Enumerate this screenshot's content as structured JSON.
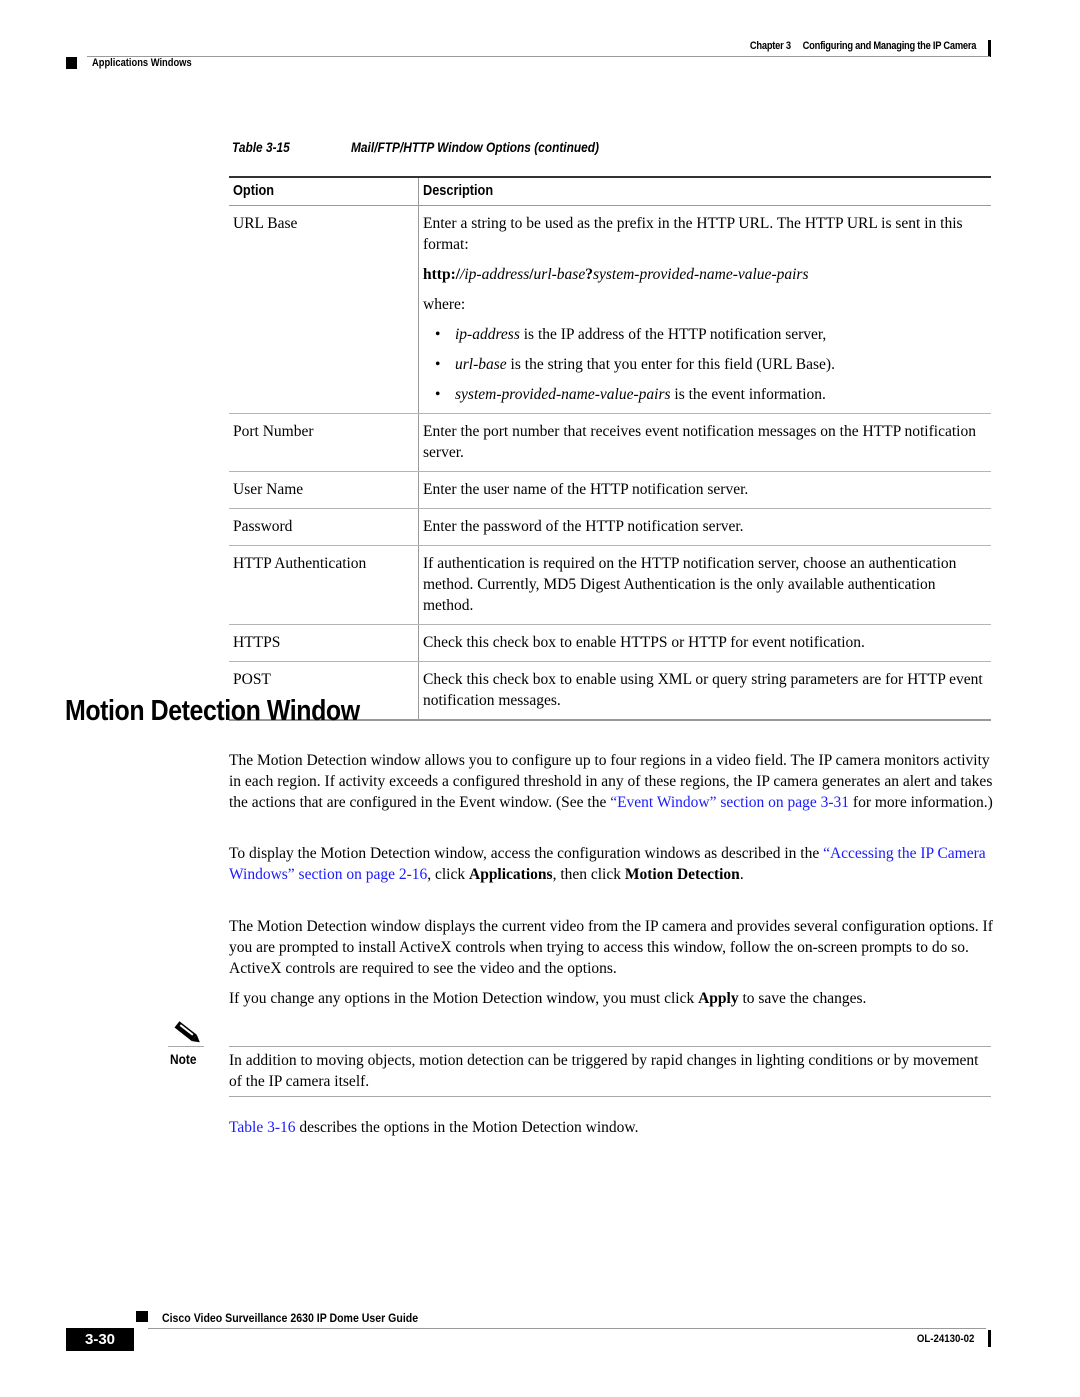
{
  "header": {
    "chapter_number": "Chapter 3",
    "chapter_title": "Configuring and Managing the IP Camera",
    "section": "Applications Windows"
  },
  "table": {
    "caption_label": "Table 3-15",
    "caption_title": "Mail/FTP/HTTP Window Options (continued)",
    "columns": [
      "Option",
      "Description"
    ],
    "rows": [
      {
        "option": "URL Base",
        "description": "Enter a string to be used as the prefix in the HTTP URL. The HTTP URL is sent in this format:",
        "format_bold_1": "http:/",
        "format_italic_1": "/ip-address",
        "format_bold_2": "/",
        "format_italic_2": "url-base",
        "format_bold_3": "?",
        "format_italic_3": "system-provided-name-value-pairs",
        "where": "where:",
        "bullets": [
          {
            "term": "ip-address",
            "text": " is the IP address of the HTTP notification server,"
          },
          {
            "term": "url-base",
            "text": " is the string that you enter for this field (URL Base)."
          },
          {
            "term": "system-provided-name-value-pairs",
            "text": " is the event information."
          }
        ]
      },
      {
        "option": "Port Number",
        "description": "Enter the port number that receives event notification messages on the HTTP notification server."
      },
      {
        "option": "User Name",
        "description": "Enter the user name of the HTTP notification server."
      },
      {
        "option": "Password",
        "description": "Enter the password of the HTTP notification server."
      },
      {
        "option": "HTTP Authentication",
        "description": "If authentication is required on the HTTP notification server, choose an authentication method. Currently, MD5 Digest Authentication is the only available authentication method."
      },
      {
        "option": "HTTPS",
        "description": "Check this check box to enable HTTPS or HTTP for event notification."
      },
      {
        "option": "POST",
        "description": "Check this check box to enable using XML or query string parameters are for HTTP event notification messages."
      }
    ]
  },
  "section": {
    "title": "Motion Detection Window",
    "p1_text": "The Motion Detection window allows you to configure up to four regions in a video field. The IP camera monitors activity in each region. If activity exceeds a configured threshold in any of these regions, the IP camera generates an alert and takes the actions that are configured in the Event window. (See the ",
    "p1_link": "“Event Window” section on page 3-31",
    "p1_tail": " for more information.)",
    "p2_text": "To display the Motion Detection window, access the configuration windows as described in the ",
    "p2_link": "“Accessing the IP Camera Windows” section on page 2-16",
    "p2_mid": ", click ",
    "p2_bold1": "Applications",
    "p2_mid2": ", then click ",
    "p2_bold2": "Motion Detection",
    "p2_tail": ".",
    "p3_text": "The Motion Detection window displays the current video from the IP camera and provides several configuration options. If you are prompted to install ActiveX controls when trying to access this window, follow the on-screen prompts to do so. ActiveX controls are required to see the video and the options.",
    "p4_text": "If you change any options in the Motion Detection window, you must click ",
    "p4_bold": "Apply",
    "p4_tail": " to save the changes.",
    "note_label": "Note",
    "note_text": "In addition to moving objects, motion detection can be triggered by rapid changes in lighting conditions or by movement of the IP camera itself.",
    "p5_link": "Table 3-16",
    "p5_tail": " describes the options in the Motion Detection window."
  },
  "footer": {
    "guide_title": "Cisco Video Surveillance 2630 IP Dome User Guide",
    "page_number": "3-30",
    "doc_number": "OL-24130-02"
  },
  "colors": {
    "link": "#1a1aff",
    "text": "#000000",
    "rule": "#9a9a9a"
  }
}
